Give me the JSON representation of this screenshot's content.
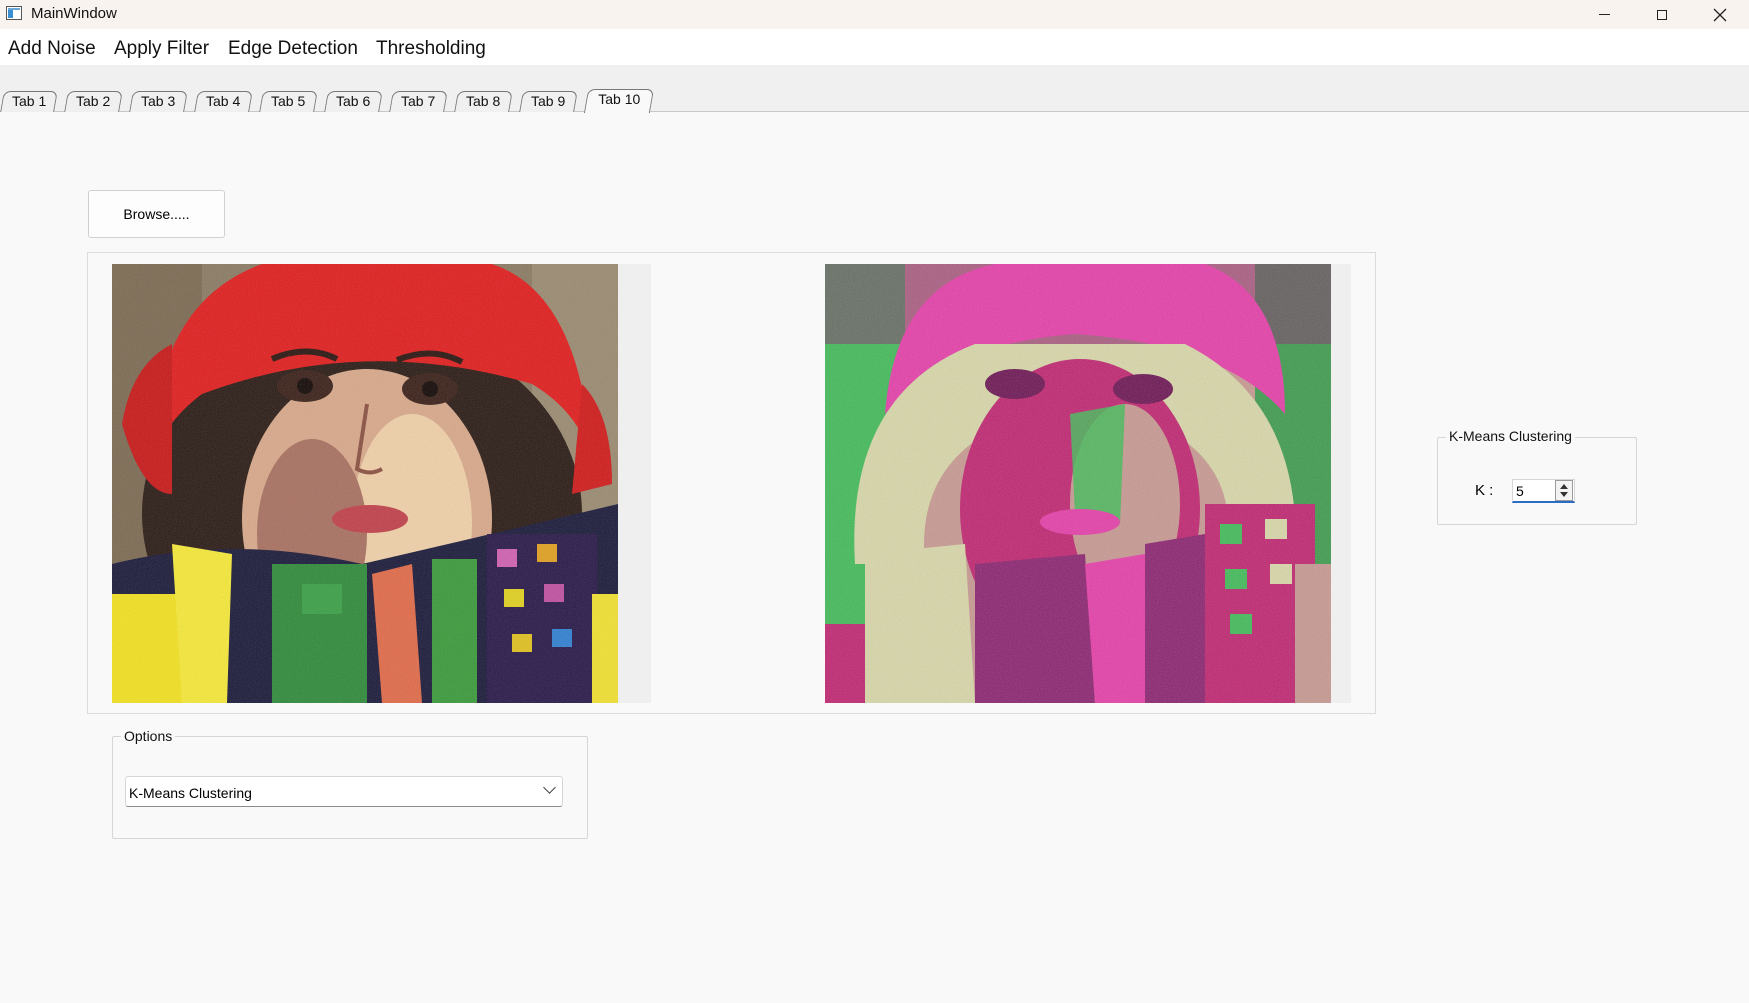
{
  "window": {
    "title": "MainWindow"
  },
  "menu": [
    "Add Noise",
    "Apply Filter",
    "Edge Detection",
    "Thresholding"
  ],
  "tabs": [
    {
      "label": "Tab 1"
    },
    {
      "label": "Tab 2"
    },
    {
      "label": "Tab 3"
    },
    {
      "label": "Tab 4"
    },
    {
      "label": "Tab 5"
    },
    {
      "label": "Tab 6"
    },
    {
      "label": "Tab 7"
    },
    {
      "label": "Tab 8"
    },
    {
      "label": "Tab 9"
    },
    {
      "label": "Tab 10"
    }
  ],
  "active_tab": "Tab 10",
  "browse_button": {
    "label": "Browse....."
  },
  "images": {
    "input": {
      "description": "noisy color photo of a woman in a red hat and patterned scarf"
    },
    "output": {
      "description": "k-means clustered version in magenta, pink, beige and green tones"
    }
  },
  "kmeans_group": {
    "title": "K-Means Clustering",
    "k_label": "K :",
    "k_value": "5"
  },
  "options_group": {
    "title": "Options",
    "selected": "K-Means Clustering"
  },
  "icons": {
    "app": "app-window-icon",
    "minimize": "minimize-icon",
    "maximize": "maximize-icon",
    "close": "close-icon",
    "combo": "chevron-down-icon"
  },
  "colors": {
    "hat_red": "#e01d1d",
    "cluster_magenta": "#e63aa8",
    "cluster_purple": "#8a1e6e",
    "cluster_beige": "#d9d8a8",
    "cluster_green": "#3dbb55",
    "cluster_pink": "#c89790",
    "focus_blue": "#2b6cc4"
  }
}
